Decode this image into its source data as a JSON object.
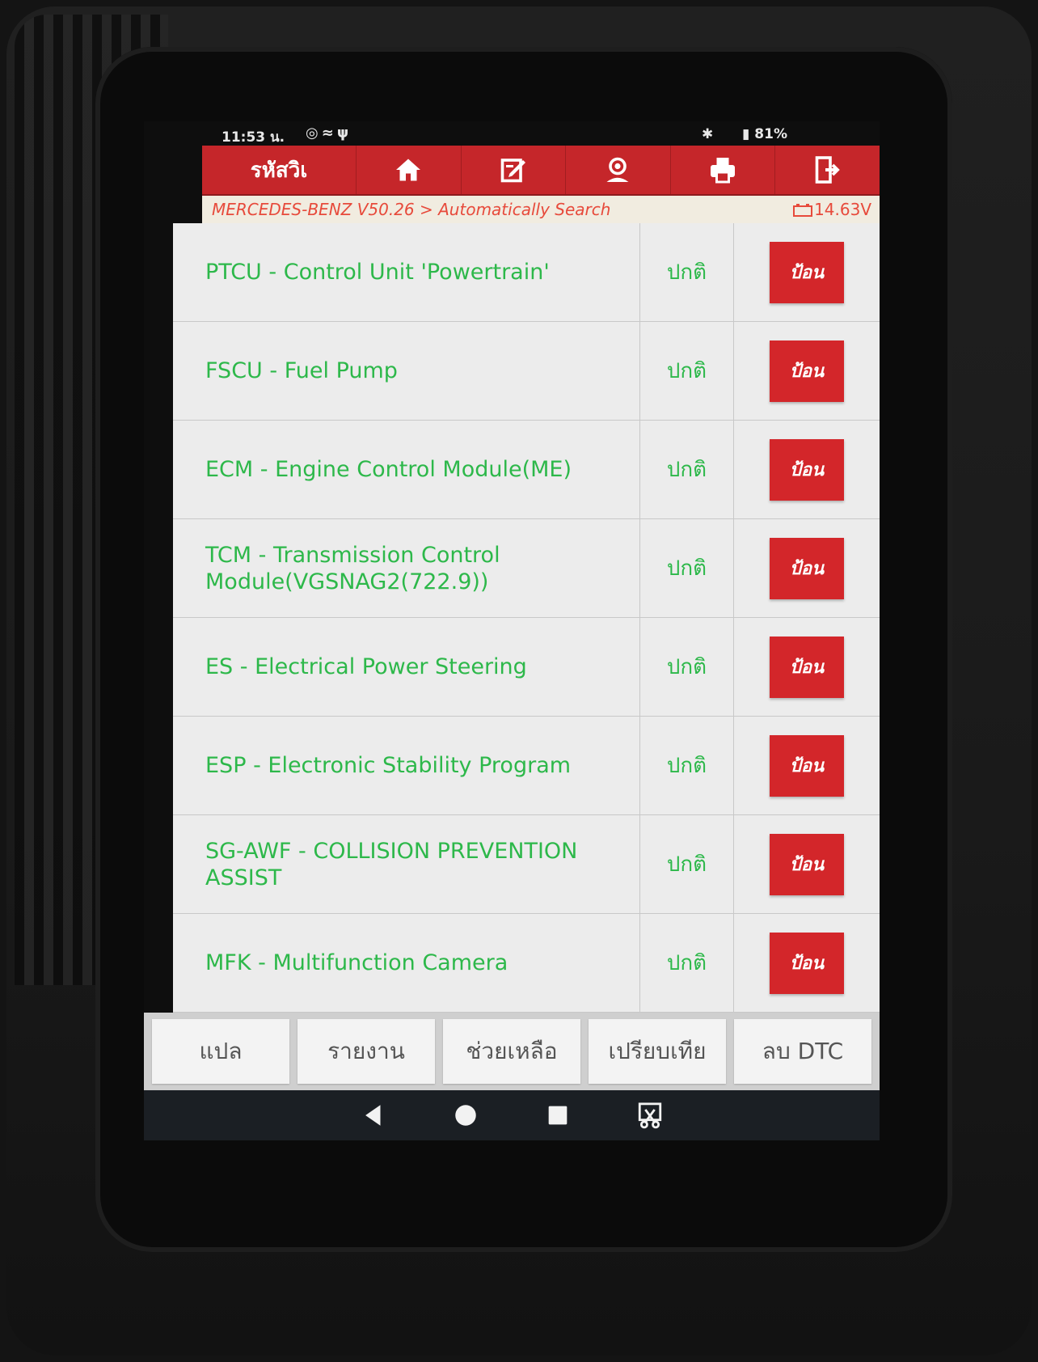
{
  "status_bar": {
    "time": "11:53 น.",
    "icons": [
      "whatsapp-icon",
      "wifi-icon",
      "usb-icon"
    ],
    "battery": "81%"
  },
  "title_bar": {
    "title": "รหัสวิเ",
    "buttons": [
      "home-icon",
      "edit-icon",
      "user-icon",
      "print-icon",
      "exit-icon"
    ]
  },
  "breadcrumb": {
    "path": "MERCEDES-BENZ V50.26 > Automatically Search",
    "voltage": "14.63V"
  },
  "systems": [
    {
      "name": "PTCU - Control Unit 'Powertrain'",
      "status": "ปกติ",
      "action": "ป้อน"
    },
    {
      "name": "FSCU - Fuel Pump",
      "status": "ปกติ",
      "action": "ป้อน"
    },
    {
      "name": "ECM - Engine Control Module(ME)",
      "status": "ปกติ",
      "action": "ป้อน"
    },
    {
      "name": "TCM - Transmission Control Module(VGSNAG2(722.9))",
      "status": "ปกติ",
      "action": "ป้อน"
    },
    {
      "name": "ES - Electrical Power Steering",
      "status": "ปกติ",
      "action": "ป้อน"
    },
    {
      "name": "ESP - Electronic Stability Program",
      "status": "ปกติ",
      "action": "ป้อน"
    },
    {
      "name": "SG-AWF - COLLISION PREVENTION ASSIST",
      "status": "ปกติ",
      "action": "ป้อน"
    },
    {
      "name": "MFK - Multifunction Camera",
      "status": "ปกติ",
      "action": "ป้อน"
    }
  ],
  "bottom_bar": {
    "translate": "แปล",
    "report": "รายงาน",
    "help": "ช่วยเหลือ",
    "compare": "เปรียบเทีย",
    "clear_dtc": "ลบ DTC"
  },
  "nav_bar": [
    "back-icon",
    "home-icon",
    "recents-icon",
    "screenshot-icon"
  ],
  "colors": {
    "accent": "#c5262a",
    "status_green": "#2db84a",
    "breadcrumb_red": "#e74a3b"
  }
}
